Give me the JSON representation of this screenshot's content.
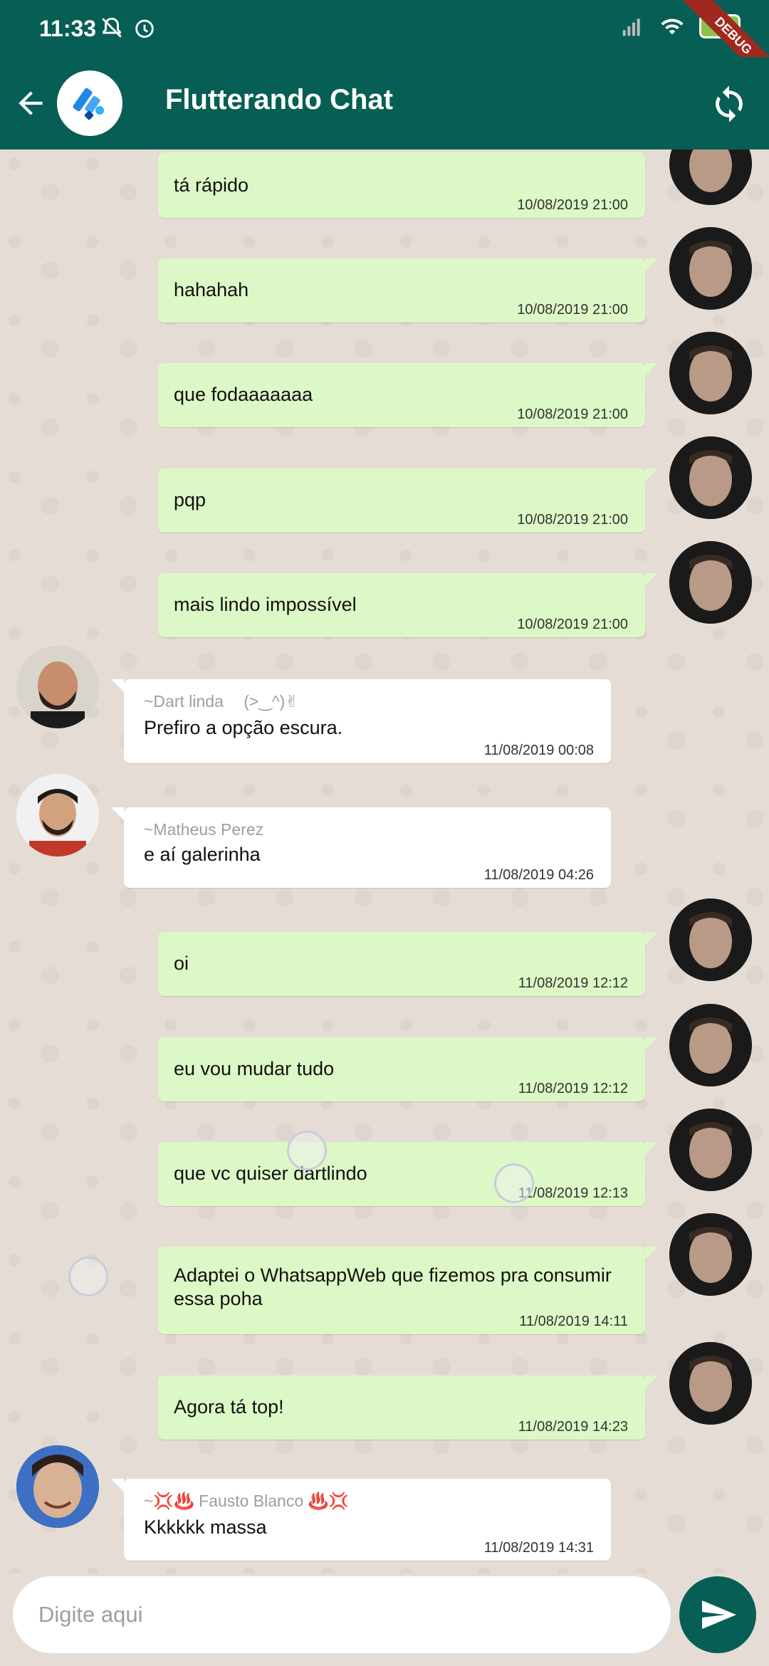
{
  "status_bar": {
    "time": "11:33",
    "battery": "86",
    "debug_label": "DEBUG"
  },
  "app_bar": {
    "title": "Flutterando Chat"
  },
  "colors": {
    "primary": "#075e54",
    "bubble_out": "#dcf8c6",
    "bubble_in": "#ffffff",
    "background": "#e5ddd5"
  },
  "messages": [
    {
      "text": "tá rápido",
      "time": "10/08/2019 21:00"
    },
    {
      "text": "hahahah",
      "time": "10/08/2019 21:00"
    },
    {
      "text": "que fodaaaaaaa",
      "time": "10/08/2019 21:00"
    },
    {
      "text": "pqp",
      "time": "10/08/2019 21:00"
    },
    {
      "text": "mais lindo impossível",
      "time": "10/08/2019 21:00"
    },
    {
      "sender": "~Dart linda",
      "sender_extra": "(>‿^)✌",
      "text": "Prefiro a opção escura.",
      "time": "11/08/2019 00:08"
    },
    {
      "sender": "~Matheus Perez",
      "text": "e aí galerinha",
      "time": "11/08/2019 04:26"
    },
    {
      "text": "oi",
      "time": "11/08/2019 12:12"
    },
    {
      "text": "eu vou mudar tudo",
      "time": "11/08/2019 12:12"
    },
    {
      "text": "que vc quiser dartlindo",
      "time": "11/08/2019 12:13"
    },
    {
      "text_line1": "Adaptei o WhatsappWeb que fizemos pra consumir",
      "text_line2": "essa poha",
      "time": "11/08/2019 14:11"
    },
    {
      "text": "Agora tá top!",
      "time": "11/08/2019 14:23"
    },
    {
      "sender": "~💢♨️ Fausto Blanco ♨️💢",
      "text": "Kkkkkk massa",
      "time": "11/08/2019 14:31"
    }
  ],
  "input": {
    "placeholder": "Digite aqui"
  }
}
